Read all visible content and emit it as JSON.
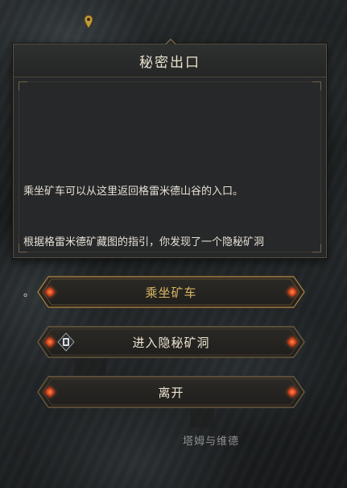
{
  "dialog": {
    "title": "秘密出口",
    "text_line1": "乘坐矿车可以从这里返回格雷米德山谷的入口。",
    "text_line2": "根据格雷米德矿藏图的指引，你发现了一个隐秘矿洞",
    "text_line3": "。"
  },
  "options": {
    "ride_label": "乘坐矿车",
    "enter_label": "进入隐秘矿洞",
    "leave_label": "离开"
  },
  "background": {
    "npc_label": "塔姆与维德"
  },
  "colors": {
    "accent_gold": "#d8b563",
    "gem_orange": "#e0522a"
  },
  "icons": {
    "map_pin": "map-pin-icon",
    "gem": "gem-icon",
    "key_hint": "key-hint-icon"
  }
}
